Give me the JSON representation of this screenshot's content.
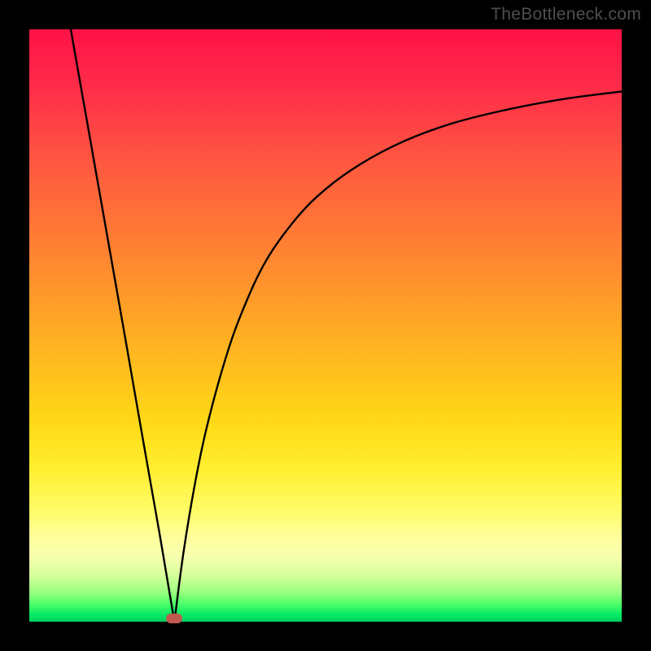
{
  "watermark": "TheBottleneck.com",
  "colors": {
    "frame": "#000000",
    "curve": "#000000",
    "marker": "#c05a50",
    "gradient_top": "#ff1246",
    "gradient_bottom": "#00d060"
  },
  "chart_data": {
    "type": "line",
    "title": "",
    "xlabel": "",
    "ylabel": "",
    "xlim": [
      0,
      1
    ],
    "ylim": [
      0,
      1
    ],
    "series": [
      {
        "name": "left-branch",
        "x": [
          0.07,
          0.1,
          0.13,
          0.16,
          0.19,
          0.22,
          0.245
        ],
        "values": [
          1.0,
          0.83,
          0.66,
          0.49,
          0.318,
          0.148,
          0.0
        ]
      },
      {
        "name": "right-branch",
        "x": [
          0.245,
          0.26,
          0.28,
          0.3,
          0.33,
          0.36,
          0.4,
          0.45,
          0.5,
          0.56,
          0.63,
          0.71,
          0.8,
          0.9,
          1.0
        ],
        "values": [
          0.0,
          0.115,
          0.235,
          0.33,
          0.44,
          0.525,
          0.61,
          0.68,
          0.73,
          0.773,
          0.81,
          0.84,
          0.863,
          0.882,
          0.895
        ]
      }
    ],
    "marker": {
      "x": 0.245,
      "y": 0.006
    },
    "notes": "x and y are normalized 0–1 within the plot area; y = 0 is the bottom (green), y = 1 is the top (red). The curve is a V-shape with a sharp minimum near x ≈ 0.245 and a slowly saturating right branch."
  }
}
